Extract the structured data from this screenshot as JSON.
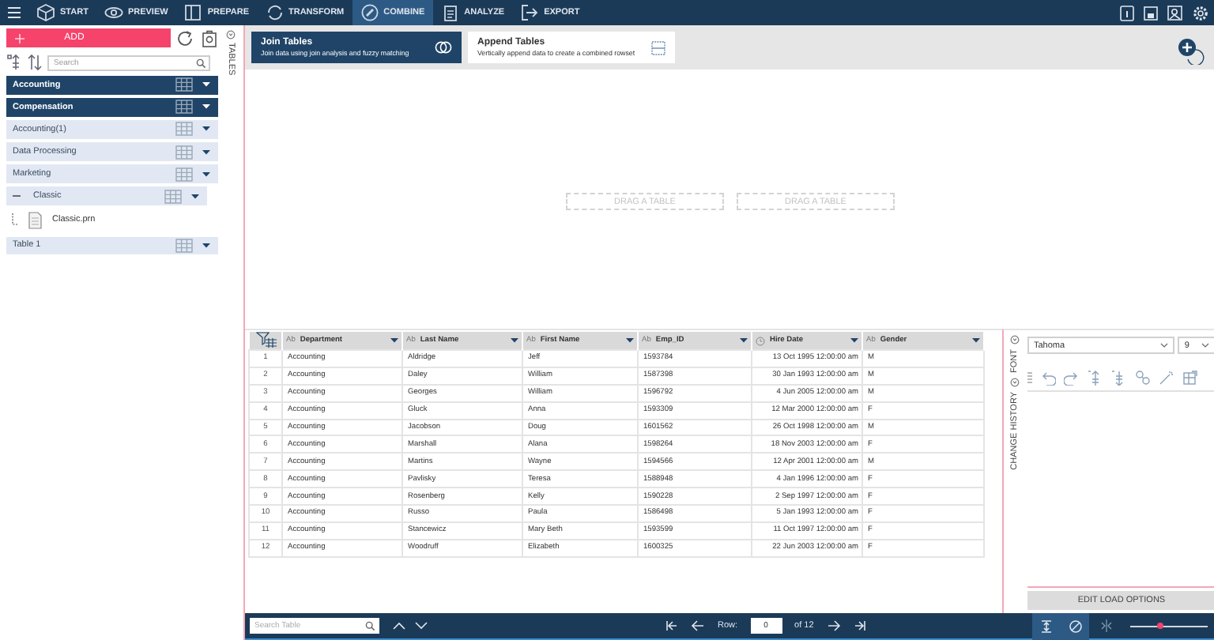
{
  "nav": {
    "tabs": [
      {
        "label": "START",
        "selected": false
      },
      {
        "label": "PREVIEW",
        "selected": false
      },
      {
        "label": "PREPARE",
        "selected": false
      },
      {
        "label": "TRANSFORM",
        "selected": false
      },
      {
        "label": "COMBINE",
        "selected": true
      },
      {
        "label": "ANALYZE",
        "selected": false
      },
      {
        "label": "EXPORT",
        "selected": false
      }
    ]
  },
  "sidebar": {
    "add_button": "ADD",
    "search": {
      "placeholder": "Search"
    },
    "tables": [
      {
        "label": "Accounting",
        "selected": true
      },
      {
        "label": "Compensation",
        "selected": true
      },
      {
        "label": "Accounting(1)",
        "selected": false
      },
      {
        "label": "Data Processing",
        "selected": false
      },
      {
        "label": "Marketing",
        "selected": false
      },
      {
        "label": "Classic",
        "selected": false,
        "expanded": true,
        "children": [
          {
            "label": "Classic.prn"
          }
        ]
      },
      {
        "label": "Table 1",
        "selected": false
      }
    ]
  },
  "tables_tab": "TABLES",
  "combine_options": [
    {
      "title": "Join Tables",
      "subtitle": "Join data using join analysis and fuzzy matching",
      "selected": true
    },
    {
      "title": "Append Tables",
      "subtitle": "Vertically append data to create a combined rowset",
      "selected": false
    }
  ],
  "drop_zones": [
    "DRAG A TABLE",
    "DRAG A TABLE"
  ],
  "grid": {
    "columns": [
      {
        "kind": "index"
      },
      {
        "type": "Ab",
        "name": "Department",
        "kind": "text"
      },
      {
        "type": "Ab",
        "name": "Last Name",
        "kind": "text"
      },
      {
        "type": "Ab",
        "name": "First Name",
        "kind": "text"
      },
      {
        "type": "Ab",
        "name": "Emp_ID",
        "kind": "text"
      },
      {
        "name": "Hire Date",
        "kind": "date"
      },
      {
        "type": "Ab",
        "name": "Gender",
        "kind": "text"
      }
    ],
    "rows": [
      [
        "1",
        "Accounting",
        "Aldridge",
        "Jeff",
        "1593784",
        "13 Oct 1995 12:00:00 am",
        "M"
      ],
      [
        "2",
        "Accounting",
        "Daley",
        "William",
        "1587398",
        "30 Jan 1993 12:00:00 am",
        "M"
      ],
      [
        "3",
        "Accounting",
        "Georges",
        "William",
        "1596792",
        "4 Jun 2005 12:00:00 am",
        "M"
      ],
      [
        "4",
        "Accounting",
        "Gluck",
        "Anna",
        "1593309",
        "12 Mar 2000 12:00:00 am",
        "F"
      ],
      [
        "5",
        "Accounting",
        "Jacobson",
        "Doug",
        "1601562",
        "26 Oct 1998 12:00:00 am",
        "M"
      ],
      [
        "6",
        "Accounting",
        "Marshall",
        "Alana",
        "1598264",
        "18 Nov 2003 12:00:00 am",
        "F"
      ],
      [
        "7",
        "Accounting",
        "Martins",
        "Wayne",
        "1594566",
        "12 Apr 2001 12:00:00 am",
        "M"
      ],
      [
        "8",
        "Accounting",
        "Pavlisky",
        "Teresa",
        "1588948",
        "4 Jan 1996 12:00:00 am",
        "F"
      ],
      [
        "9",
        "Accounting",
        "Rosenberg",
        "Kelly",
        "1590228",
        "2 Sep 1997 12:00:00 am",
        "F"
      ],
      [
        "10",
        "Accounting",
        "Russo",
        "Paula",
        "1586498",
        "5 Jan 1993 12:00:00 am",
        "F"
      ],
      [
        "11",
        "Accounting",
        "Stancewicz",
        "Mary Beth",
        "1593599",
        "11 Oct 1997 12:00:00 am",
        "F"
      ],
      [
        "12",
        "Accounting",
        "Woodruff",
        "Elizabeth",
        "1600325",
        "22 Jun 2003 12:00:00 am",
        "F"
      ]
    ]
  },
  "right_panel": {
    "tabs": [
      "FONT",
      "CHANGE HISTORY"
    ],
    "font": "Tahoma",
    "size": "9",
    "button": "EDIT LOAD OPTIONS"
  },
  "bottom_bar": {
    "search": {
      "placeholder": "Search Table"
    },
    "row_label": "Row:",
    "row_value": "0",
    "row_total": "of 12",
    "zoom": {
      "level": 0.38
    }
  }
}
